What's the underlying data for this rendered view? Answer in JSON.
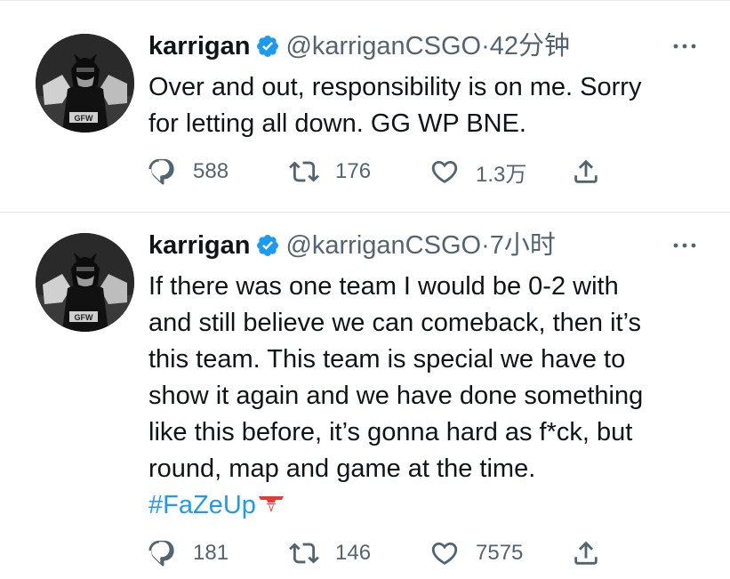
{
  "tweets": [
    {
      "name": "karrigan",
      "handle": "@karriganCSGO",
      "dot": "·",
      "time": "42分钟",
      "lines": [
        "Over and out, responsibility is on me. Sorry",
        "for letting all down. GG WP BNE."
      ],
      "hashtag": "",
      "replies": "588",
      "retweets": "176",
      "likes": "1.3万"
    },
    {
      "name": "karrigan",
      "handle": "@karriganCSGO",
      "dot": "·",
      "time": "7小时",
      "lines": [
        "If there was one team I would be 0-2 with",
        "and still believe we can comeback, then it’s",
        "this team. This team is special we have to",
        "show it again and we have done something",
        "like this before, it’s gonna hard as f*ck, but",
        "round, map and game at the time."
      ],
      "hashtag": "#FaZeUp",
      "replies": "181",
      "retweets": "146",
      "likes": "7575"
    }
  ],
  "colors": {
    "text": "#0f1419",
    "secondary": "#536471",
    "verified": "#1d9bf0",
    "hashtag": "#1d9bf0",
    "faze": "#e43d30"
  },
  "icons": [
    "verified-badge-icon",
    "more-icon",
    "reply-icon",
    "retweet-icon",
    "like-icon",
    "share-icon",
    "faze-logo-icon"
  ]
}
